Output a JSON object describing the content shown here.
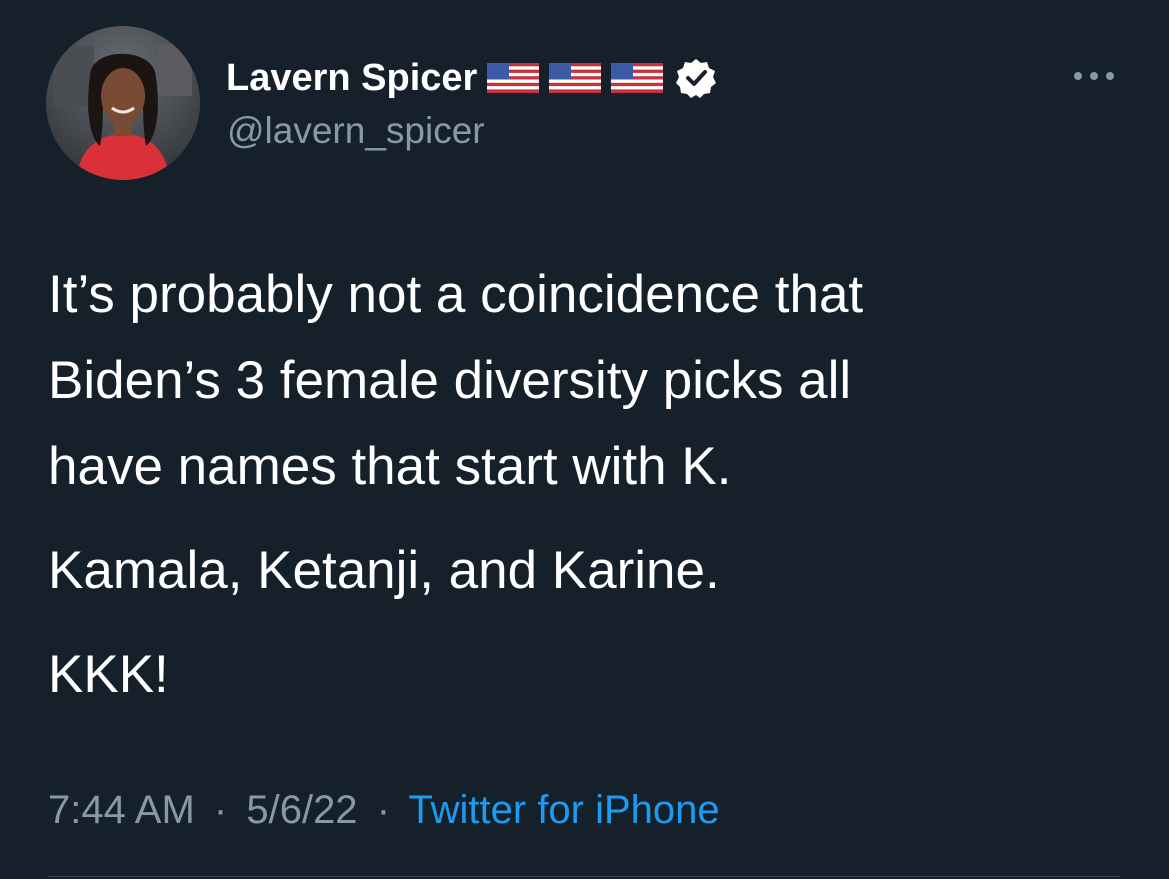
{
  "author": {
    "display_name": "Lavern Spicer",
    "handle": "@lavern_spicer",
    "flag_emojis": [
      "us-flag-icon",
      "us-flag-icon",
      "us-flag-icon"
    ],
    "verified": true
  },
  "tweet": {
    "lines": [
      "It’s probably not a coincidence that",
      "Biden’s 3 female diversity picks all",
      "have names that start with K."
    ],
    "line2": "Kamala, Ketanji, and Karine.",
    "line3": "KKK!"
  },
  "meta": {
    "time": "7:44 AM",
    "separator": "·",
    "date": "5/6/22",
    "source": "Twitter for iPhone"
  },
  "colors": {
    "background": "#15202b",
    "text_primary": "#ffffff",
    "text_secondary": "#8899a6",
    "link": "#1d9bf0",
    "verified_badge": "#ffffff"
  }
}
